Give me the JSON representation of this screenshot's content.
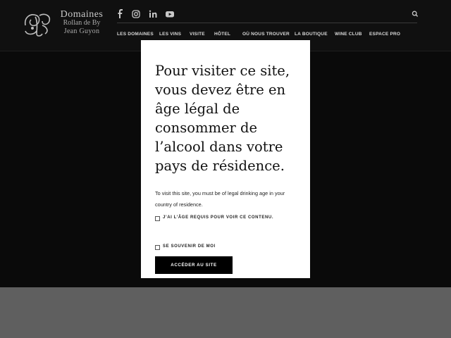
{
  "header": {
    "logo": {
      "line1": "Domaines",
      "line2": "Rollan de By",
      "line3": "Jean Guyon"
    },
    "social_icons": [
      "facebook-icon",
      "instagram-icon",
      "linkedin-icon",
      "youtube-icon"
    ],
    "nav": [
      "LES DOMAINES",
      "LES VINS",
      "VISITE",
      "HÔTEL",
      "OÙ NOUS TROUVER",
      "LA BOUTIQUE",
      "WINE CLUB",
      "ESPACE PRO"
    ]
  },
  "age_gate": {
    "heading": "Pour visiter ce site, vous devez être en âge légal de consommer de l’alcool dans votre pays de résidence.",
    "subtext": "To visit this site, you must be of legal drinking age in your country of residence.",
    "age_checkbox_label": "J’AI L’ÂGE REQUIS POUR VOIR CE CONTENU.",
    "remember_checkbox_label": "SE SOUVENIR DE MOI",
    "submit_label": "ACCÉDER AU SITE"
  },
  "colors": {
    "page_background": "#0b0b0b",
    "header_background": "#101010",
    "footer_band": "#5f5f5f",
    "modal_background": "#ffffff",
    "button_background": "#000000"
  }
}
